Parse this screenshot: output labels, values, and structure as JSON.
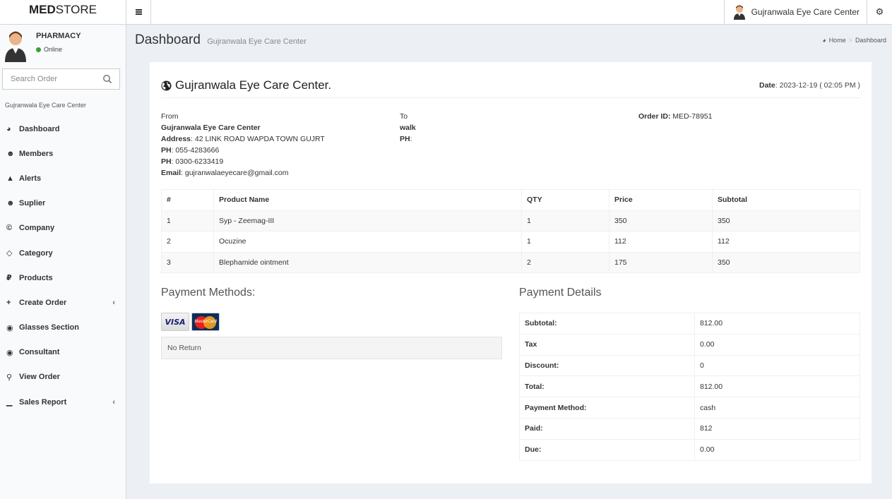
{
  "brand": {
    "bold": "MED",
    "rest": "STORE"
  },
  "header": {
    "user_name": "Gujranwala Eye Care Center"
  },
  "sidebar": {
    "user": {
      "name": "PHARMACY",
      "status": "Online"
    },
    "search_placeholder": "Search Order",
    "section_label": "Gujranwala Eye Care Center",
    "items": [
      {
        "label": "Dashboard",
        "icon": "dashboard-icon",
        "glyph": "◕"
      },
      {
        "label": "Members",
        "icon": "users-icon",
        "glyph": "☻"
      },
      {
        "label": "Alerts",
        "icon": "warning-icon",
        "glyph": "▲"
      },
      {
        "label": "Suplier",
        "icon": "users-icon",
        "glyph": "☻"
      },
      {
        "label": "Company",
        "icon": "copyright-icon",
        "glyph": "©"
      },
      {
        "label": "Category",
        "icon": "diamond-icon",
        "glyph": "◇"
      },
      {
        "label": "Products",
        "icon": "ruble-icon",
        "glyph": "₽"
      },
      {
        "label": "Create Order",
        "icon": "plus-icon",
        "glyph": "+"
      },
      {
        "label": "Glasses Section",
        "icon": "eye-icon",
        "glyph": "◉"
      },
      {
        "label": "Consultant",
        "icon": "eye-icon",
        "glyph": "◉"
      },
      {
        "label": "View Order",
        "icon": "search-icon",
        "glyph": "⚲"
      },
      {
        "label": "Sales Report",
        "icon": "bar-chart-icon",
        "glyph": "▁"
      }
    ]
  },
  "page": {
    "title": "Dashboard",
    "subtitle": "Gujranwala Eye Care Center"
  },
  "breadcrumb": {
    "home": "Home",
    "current": "Dashboard"
  },
  "invoice": {
    "title": "Gujranwala Eye Care Center.",
    "date_label": "Date",
    "date_value": ": 2023-12-19 ( 02:05 PM )",
    "from": {
      "label": "From",
      "name": "Gujranwala Eye Care Center",
      "address_label": "Address",
      "address": ": 42 LINK ROAD WAPDA TOWN GUJRT",
      "ph1_label": "PH",
      "ph1": ": 055-4283666",
      "ph2_label": "PH",
      "ph2": ": 0300-6233419",
      "email_label": "Email",
      "email": ": gujranwalaeyecare@gmail.com"
    },
    "to": {
      "label": "To",
      "name": "walk",
      "ph_label": "PH",
      "ph": ":"
    },
    "order": {
      "label": "Order ID:",
      "value": " MED-78951"
    },
    "table": {
      "headers": [
        "#",
        "Product Name",
        "QTY",
        "Price",
        "Subtotal"
      ],
      "rows": [
        [
          "1",
          "Syp - Zeemag-III",
          "1",
          "350",
          "350"
        ],
        [
          "2",
          "Ocuzine",
          "1",
          "112",
          "112"
        ],
        [
          "3",
          "Blephamide ointment",
          "2",
          "175",
          "350"
        ]
      ]
    },
    "payment_methods_title": "Payment Methods:",
    "cards": {
      "visa": "VISA",
      "mastercard": "MasterCard"
    },
    "note": "No Return",
    "payment_details_title": "Payment Details",
    "details": [
      {
        "label": "Subtotal:",
        "value": "812.00"
      },
      {
        "label": "Tax",
        "value": "0.00"
      },
      {
        "label": "Discount:",
        "value": "0"
      },
      {
        "label": "Total:",
        "value": "812.00"
      },
      {
        "label": "Payment Method:",
        "value": "cash"
      },
      {
        "label": "Paid:",
        "value": "812"
      },
      {
        "label": "Due:",
        "value": "0.00"
      }
    ]
  }
}
